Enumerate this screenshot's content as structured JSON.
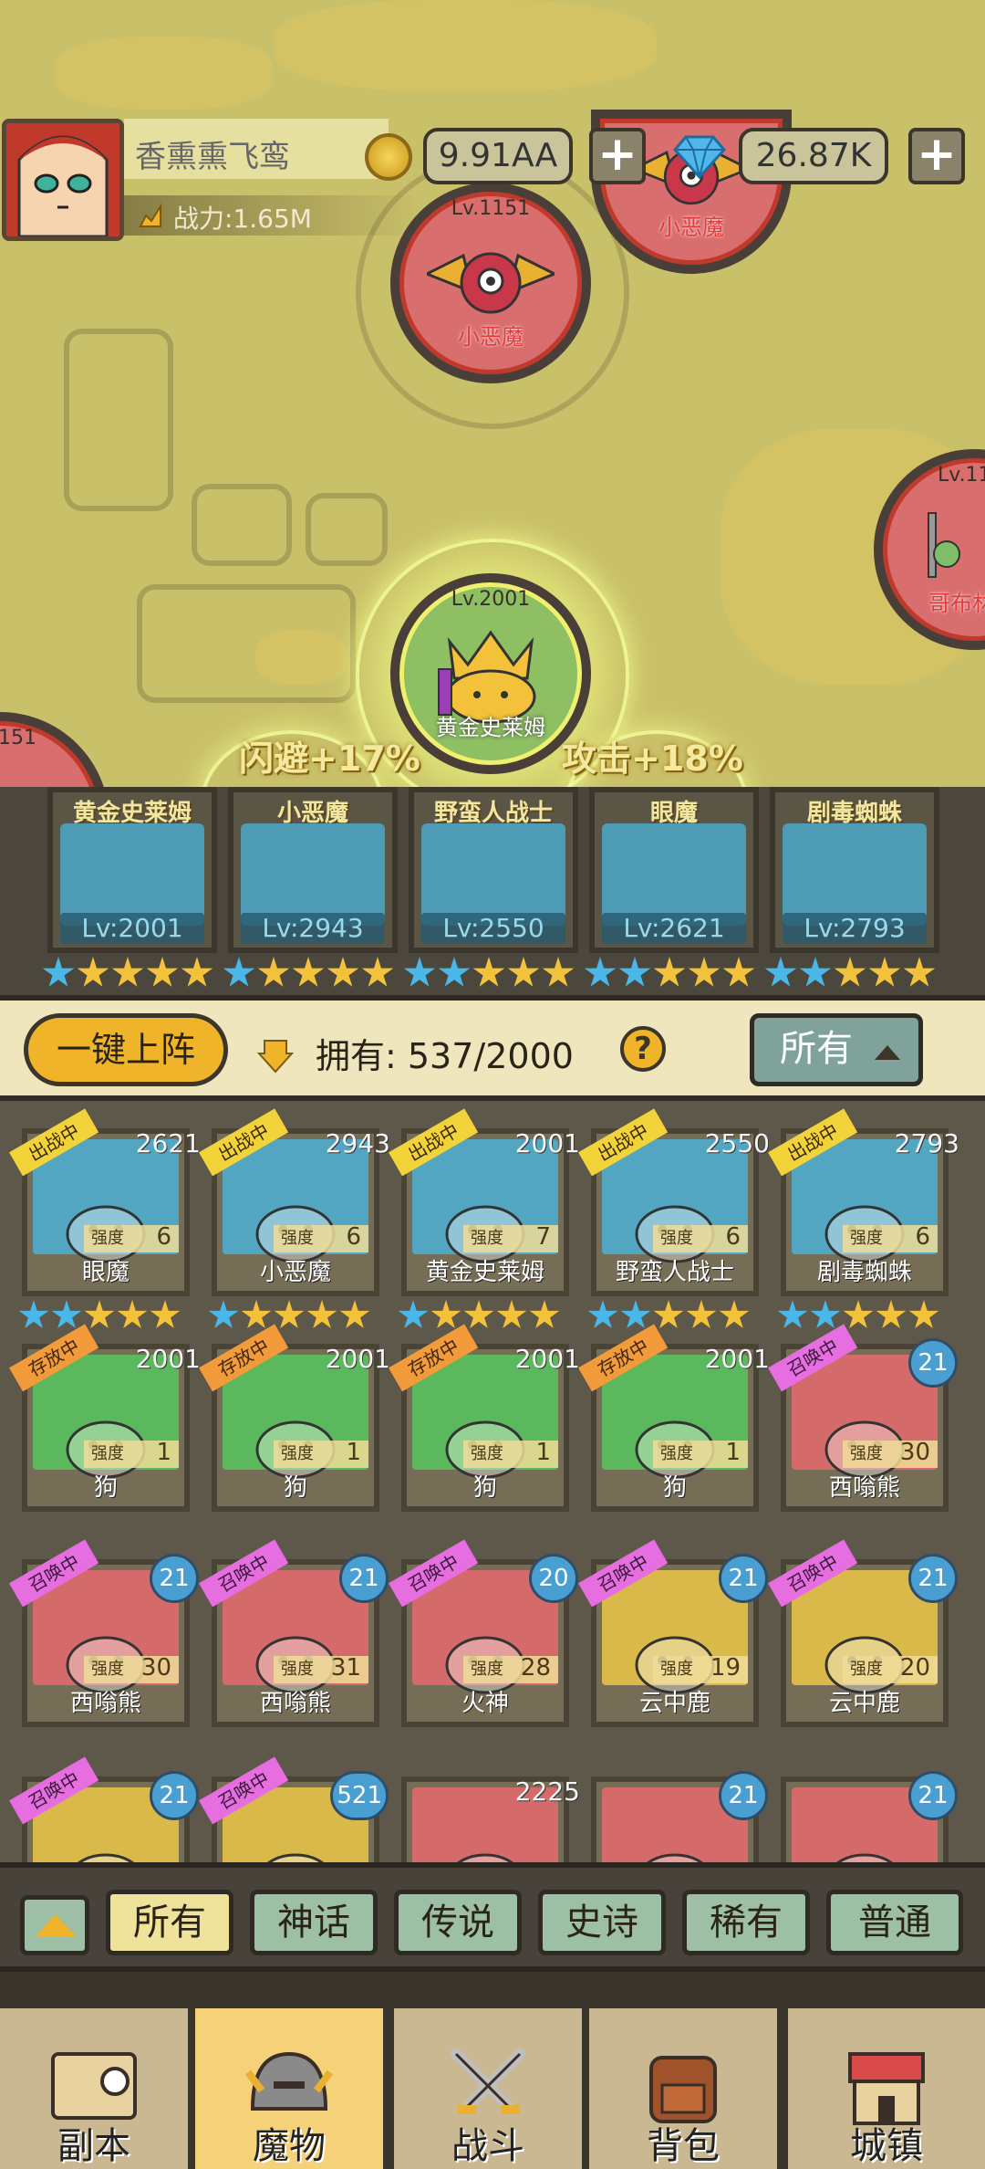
{
  "player": {
    "nickname": "香熏熏飞鸾",
    "power_label": "战力:1.65M",
    "gold": "9.91AA",
    "gems": "26.87K"
  },
  "map_nodes": [
    {
      "lv": "Lv.1151",
      "name": "小恶魔"
    },
    {
      "lv": "",
      "name": "小恶魔"
    },
    {
      "lv": "Lv.11",
      "name": "哥布林"
    },
    {
      "lv": "Lv.2001",
      "name": "黄金史莱姆"
    },
    {
      "lv": "1151",
      "name": ""
    }
  ],
  "buffs": [
    "闪避+17%",
    "攻击+18%"
  ],
  "team": [
    {
      "name": "黄金史莱姆",
      "lv": "Lv:2001",
      "blue_stars": 1,
      "gold_stars": 4
    },
    {
      "name": "小恶魔",
      "lv": "Lv:2943",
      "blue_stars": 1,
      "gold_stars": 4
    },
    {
      "name": "野蛮人战士",
      "lv": "Lv:2550",
      "blue_stars": 2,
      "gold_stars": 3
    },
    {
      "name": "眼魔",
      "lv": "Lv:2621",
      "blue_stars": 2,
      "gold_stars": 3
    },
    {
      "name": "剧毒蜘蛛",
      "lv": "Lv:2793",
      "blue_stars": 2,
      "gold_stars": 3
    }
  ],
  "own": {
    "one_key_label": "一键上阵",
    "own_text": "拥有: 537/2000",
    "help": "?",
    "filter": "所有"
  },
  "monsters": [
    {
      "name": "眼魔",
      "tag": "出战中",
      "tag_type": "battle",
      "lv": "2621",
      "strength": "6",
      "color": "blue",
      "blue_stars": 2,
      "gold_stars": 3
    },
    {
      "name": "小恶魔",
      "tag": "出战中",
      "tag_type": "battle",
      "lv": "2943",
      "strength": "6",
      "color": "blue",
      "blue_stars": 1,
      "gold_stars": 4
    },
    {
      "name": "黄金史莱姆",
      "tag": "出战中",
      "tag_type": "battle",
      "lv": "2001",
      "strength": "7",
      "color": "blue",
      "blue_stars": 1,
      "gold_stars": 4
    },
    {
      "name": "野蛮人战士",
      "tag": "出战中",
      "tag_type": "battle",
      "lv": "2550",
      "strength": "6",
      "color": "blue",
      "blue_stars": 2,
      "gold_stars": 3
    },
    {
      "name": "剧毒蜘蛛",
      "tag": "出战中",
      "tag_type": "battle",
      "lv": "2793",
      "strength": "6",
      "color": "blue",
      "blue_stars": 2,
      "gold_stars": 3
    },
    {
      "name": "狗",
      "tag": "存放中",
      "tag_type": "store",
      "lv": "2001",
      "strength": "1",
      "color": "green"
    },
    {
      "name": "狗",
      "tag": "存放中",
      "tag_type": "store",
      "lv": "2001",
      "strength": "1",
      "color": "green"
    },
    {
      "name": "狗",
      "tag": "存放中",
      "tag_type": "store",
      "lv": "2001",
      "strength": "1",
      "color": "green"
    },
    {
      "name": "狗",
      "tag": "存放中",
      "tag_type": "store",
      "lv": "2001",
      "strength": "1",
      "color": "green"
    },
    {
      "name": "西嗡熊",
      "tag": "召唤中",
      "tag_type": "summon",
      "lv": "21",
      "strength": "30",
      "color": "red",
      "badge": true
    },
    {
      "name": "西嗡熊",
      "tag": "召唤中",
      "tag_type": "summon",
      "lv": "21",
      "strength": "30",
      "color": "red",
      "badge": true
    },
    {
      "name": "西嗡熊",
      "tag": "召唤中",
      "tag_type": "summon",
      "lv": "21",
      "strength": "31",
      "color": "red",
      "badge": true
    },
    {
      "name": "火神",
      "tag": "召唤中",
      "tag_type": "summon",
      "lv": "20",
      "strength": "28",
      "color": "red",
      "badge": true
    },
    {
      "name": "云中鹿",
      "tag": "召唤中",
      "tag_type": "summon",
      "lv": "21",
      "strength": "19",
      "color": "gold",
      "badge": true
    },
    {
      "name": "云中鹿",
      "tag": "召唤中",
      "tag_type": "summon",
      "lv": "21",
      "strength": "20",
      "color": "gold",
      "badge": true
    },
    {
      "name": "",
      "tag": "召唤中",
      "tag_type": "summon",
      "lv": "21",
      "strength": "",
      "color": "gold",
      "badge": true
    },
    {
      "name": "",
      "tag": "召唤中",
      "tag_type": "summon",
      "lv": "521",
      "strength": "",
      "color": "gold",
      "badge": true
    },
    {
      "name": "",
      "tag": "",
      "tag_type": "",
      "lv": "2225",
      "strength": "",
      "color": "red"
    },
    {
      "name": "",
      "tag": "",
      "tag_type": "",
      "lv": "21",
      "strength": "",
      "color": "red",
      "badge": true
    },
    {
      "name": "",
      "tag": "",
      "tag_type": "",
      "lv": "21",
      "strength": "",
      "color": "red",
      "badge": true
    }
  ],
  "strength_label": "强度",
  "rarity_filters": [
    "所有",
    "神话",
    "传说",
    "史诗",
    "稀有",
    "普通"
  ],
  "nav": [
    "副本",
    "魔物",
    "战斗",
    "背包",
    "城镇"
  ],
  "colors": {
    "accent": "#f0b42a",
    "battle_tag": "#f2d43a",
    "store_tag": "#f39a3a",
    "summon_tag": "#e66ee0",
    "star_blue": "#49b8e8",
    "star_gold": "#f3c23a"
  }
}
